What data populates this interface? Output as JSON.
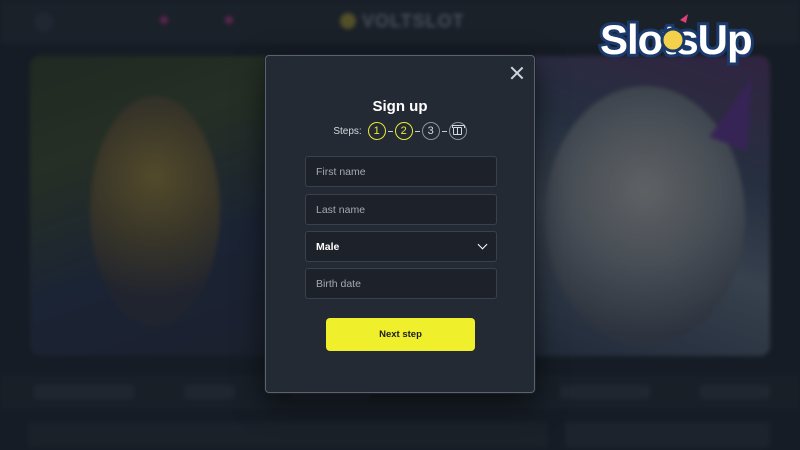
{
  "watermark": {
    "brand": "SlotsUp"
  },
  "site": {
    "logo_text": "VOLTSLOT"
  },
  "modal": {
    "title": "Sign up",
    "steps_label": "Steps:",
    "steps": [
      "1",
      "2",
      "3"
    ],
    "active_steps": [
      1,
      2
    ],
    "fields": {
      "first_name_placeholder": "First name",
      "last_name_placeholder": "Last name",
      "gender_value": "Male",
      "birth_date_placeholder": "Birth date"
    },
    "next_button_label": "Next step"
  },
  "colors": {
    "accent": "#f0ef2b",
    "modal_bg": "#242a33",
    "field_bg": "#1d222a"
  }
}
